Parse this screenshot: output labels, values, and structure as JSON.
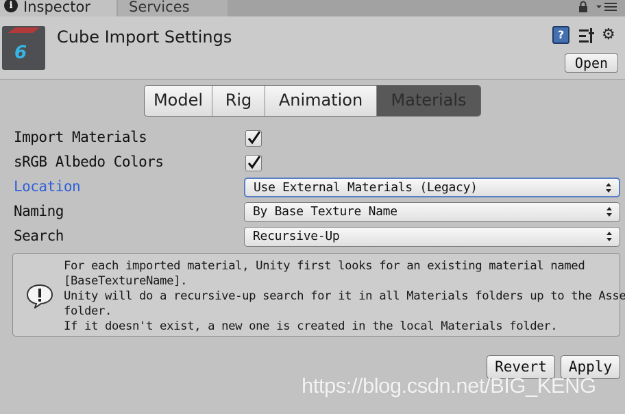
{
  "tabs": [
    {
      "label": "Inspector",
      "active": true
    },
    {
      "label": "Services",
      "active": false
    }
  ],
  "header": {
    "title": "Cube Import Settings",
    "open_label": "Open",
    "asset_icon_glyph": "6",
    "help_glyph": "?",
    "gear_glyph": "⚙"
  },
  "segments": [
    {
      "label": "Model",
      "selected": false
    },
    {
      "label": "Rig",
      "selected": false
    },
    {
      "label": "Animation",
      "selected": false
    },
    {
      "label": "Materials",
      "selected": true
    }
  ],
  "properties": {
    "import_materials": {
      "label": "Import Materials",
      "checked": true
    },
    "srgb_albedo": {
      "label": "sRGB Albedo Colors",
      "checked": true
    },
    "location": {
      "label": "Location",
      "value": "Use External Materials (Legacy)"
    },
    "naming": {
      "label": "Naming",
      "value": "By Base Texture Name"
    },
    "search": {
      "label": "Search",
      "value": "Recursive-Up"
    }
  },
  "help_box": {
    "lines": [
      "For each imported material, Unity first looks for an existing material named",
      "[BaseTextureName].",
      "Unity will do a recursive-up search for it in all Materials folders up to the Assets",
      "folder.",
      "If it doesn't exist, a new one is created in the local Materials folder."
    ]
  },
  "footer": {
    "revert_label": "Revert",
    "apply_label": "Apply"
  },
  "watermark": "https://blog.csdn.net/BIG_KENG",
  "colors": {
    "background": "#c2c2c2",
    "link_label": "#2f5fd8",
    "selected_segment": "#585858",
    "focus_border": "#5a7ec4"
  }
}
